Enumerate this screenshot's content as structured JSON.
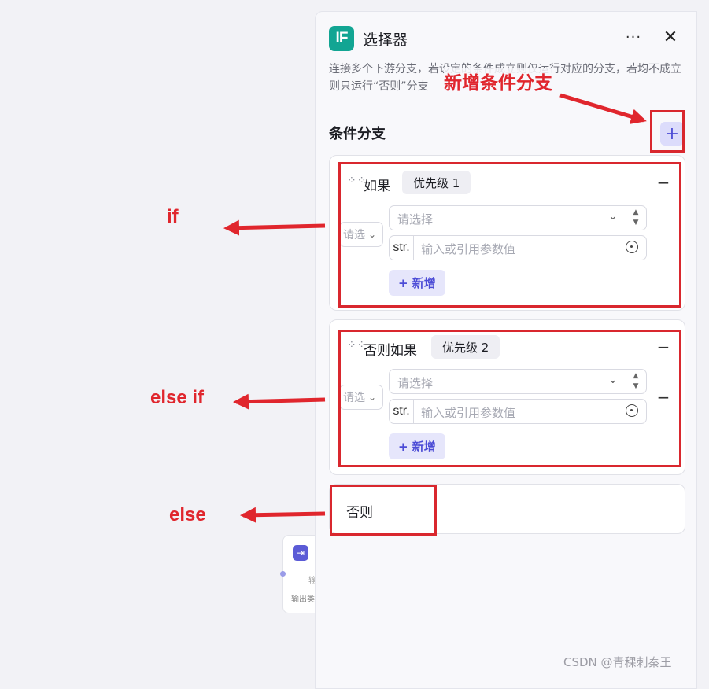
{
  "canvas_node": {
    "label_1": "输",
    "label_2": "输出类"
  },
  "panel": {
    "icon": "IF",
    "title": "选择器",
    "more": "···",
    "close": "✕",
    "description": "连接多个下游分支，若设定的条件成立则仅运行对应的分支，若均不成立则只运行“否则”分支",
    "section_title": "条件分支",
    "add_branch": "+"
  },
  "branches": [
    {
      "label": "如果",
      "priority": "优先级 1",
      "logic_placeholder": "请选",
      "var_placeholder": "请选择",
      "value_type": "str.",
      "value_placeholder": "输入或引用参数值",
      "add_condition": "+ 新增"
    },
    {
      "label": "否则如果",
      "priority": "优先级 2",
      "logic_placeholder": "请选",
      "var_placeholder": "请选择",
      "value_type": "str.",
      "value_placeholder": "输入或引用参数值",
      "add_condition": "+ 新增"
    }
  ],
  "else_branch": {
    "label": "否则"
  },
  "annotations": {
    "add_branch": "新增条件分支",
    "if": "if",
    "else_if": "else if",
    "else": "else",
    "color": "#e0262d"
  },
  "watermark": "CSDN @青稞刺秦王"
}
